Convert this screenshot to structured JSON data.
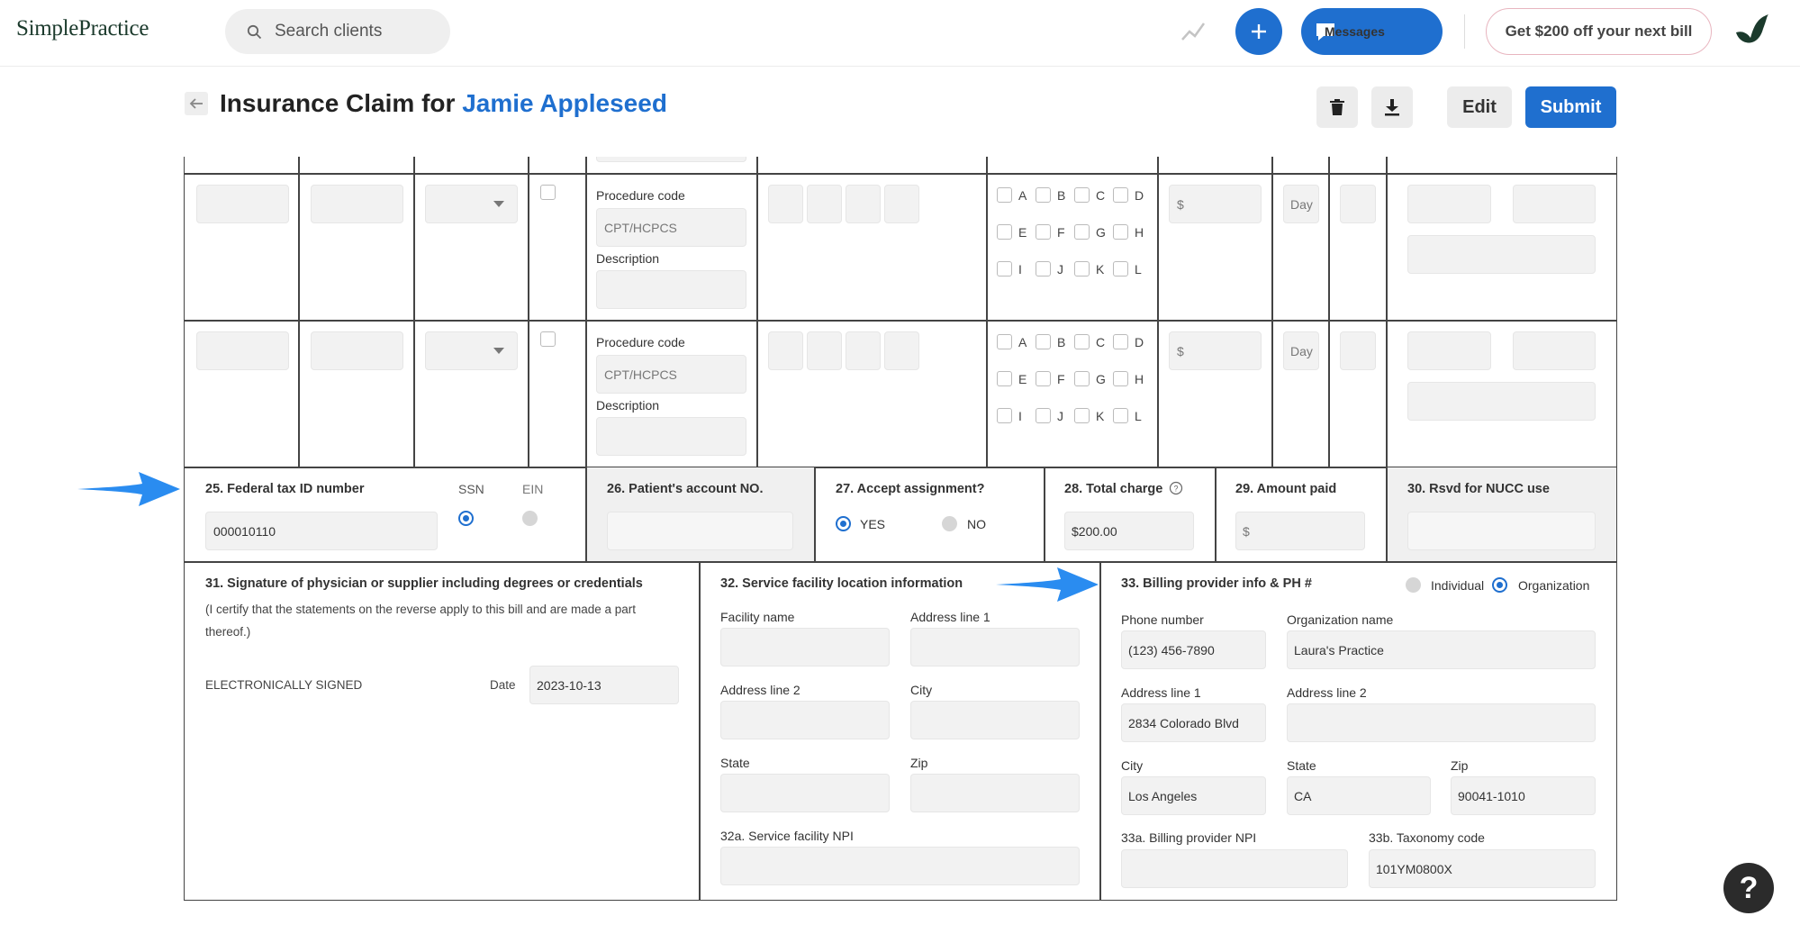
{
  "app": {
    "logo": "SimplePractice",
    "search_placeholder": "Search clients",
    "messages_label": "Messages",
    "promo_label": "Get $200 off your next bill"
  },
  "header": {
    "title_prefix": "Insurance Claim for",
    "client_name": "Jamie Appleseed",
    "edit_label": "Edit",
    "submit_label": "Submit"
  },
  "service_lines": {
    "procedure_code_label": "Procedure code",
    "procedure_code_placeholder": "CPT/HCPCS",
    "description_label": "Description",
    "charge_placeholder": "$",
    "days_placeholder": "Day",
    "diagnosis_pointers": [
      "A",
      "B",
      "C",
      "D",
      "E",
      "F",
      "G",
      "H",
      "I",
      "J",
      "K",
      "L"
    ]
  },
  "fields": {
    "f25": {
      "label": "25. Federal tax ID number",
      "ssn_label": "SSN",
      "ein_label": "EIN",
      "value": "000010110",
      "selected": "SSN"
    },
    "f26": {
      "label": "26. Patient's account NO.",
      "value": ""
    },
    "f27": {
      "label": "27. Accept assignment?",
      "yes_label": "YES",
      "no_label": "NO",
      "selected": "YES"
    },
    "f28": {
      "label": "28. Total charge",
      "value": "$200.00"
    },
    "f29": {
      "label": "29. Amount paid",
      "placeholder": "$"
    },
    "f30": {
      "label": "30. Rsvd for NUCC use"
    },
    "f31": {
      "label": "31. Signature of physician or supplier including degrees or credentials",
      "note": "(I certify that the statements on the reverse apply to this bill and are made a part thereof.)",
      "signed": "ELECTRONICALLY SIGNED",
      "date_label": "Date",
      "date_value": "2023-10-13"
    },
    "f32": {
      "label": "32. Service facility location information",
      "facility_name_label": "Facility name",
      "address1_label": "Address line 1",
      "address2_label": "Address line 2",
      "city_label": "City",
      "state_label": "State",
      "zip_label": "Zip",
      "npi_label": "32a. Service facility NPI"
    },
    "f33": {
      "label": "33. Billing provider info & PH #",
      "individual_label": "Individual",
      "organization_label": "Organization",
      "selected": "Organization",
      "phone_label": "Phone number",
      "phone_value": "(123) 456-7890",
      "org_label": "Organization name",
      "org_value": "Laura's Practice",
      "address1_label": "Address line 1",
      "address1_value": "2834 Colorado Blvd",
      "address2_label": "Address line 2",
      "city_label": "City",
      "city_value": "Los Angeles",
      "state_label": "State",
      "state_value": "CA",
      "zip_label": "Zip",
      "zip_value": "90041-1010",
      "npi_label": "33a. Billing provider NPI",
      "taxonomy_label": "33b. Taxonomy code",
      "taxonomy_value": "101YM0800X"
    }
  },
  "help_label": "?",
  "colors": {
    "primary": "#1f6fcf",
    "arrow": "#2a8cf0"
  },
  "icons": [
    "search-icon",
    "trend-icon",
    "plus-icon",
    "chat-icon",
    "brand-leaf-icon",
    "back-arrow-icon",
    "trash-icon",
    "download-icon",
    "info-icon",
    "dropdown-caret-icon",
    "pointer-arrow-icon",
    "help-icon"
  ]
}
